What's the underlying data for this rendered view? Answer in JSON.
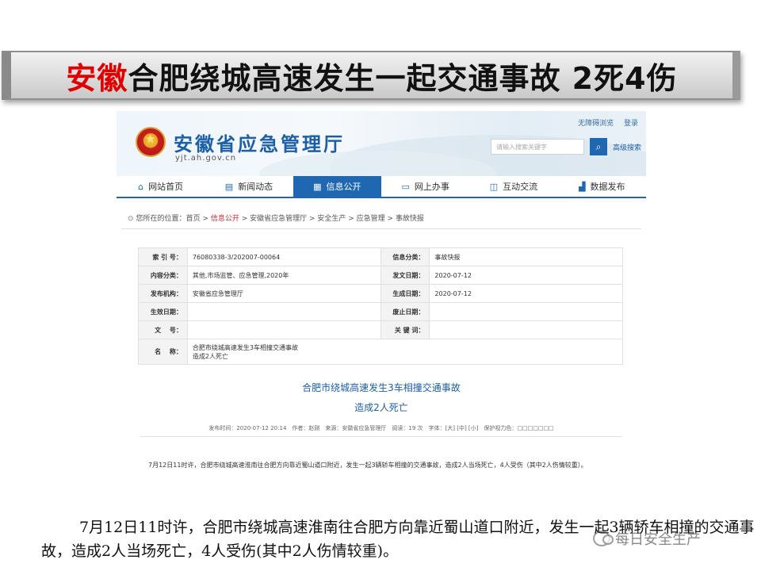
{
  "slide_title": {
    "part_red": "安徽",
    "part_dark": "合肥绕城高速发生一起交通事故 2死4伤"
  },
  "site": {
    "name": "安徽省应急管理厅",
    "domain": "yjt.ah.gov.cn",
    "top_links": [
      "无障碍浏览",
      "登录"
    ],
    "search_placeholder": "请输入搜索关键字",
    "search_icon": "search-icon",
    "advanced_search": "高级搜索",
    "nav": [
      {
        "label": "网站首页",
        "icon": "home-icon"
      },
      {
        "label": "新闻动态",
        "icon": "news-icon"
      },
      {
        "label": "信息公开",
        "icon": "info-icon",
        "active": true
      },
      {
        "label": "网上办事",
        "icon": "monitor-icon"
      },
      {
        "label": "互动交流",
        "icon": "chat-icon"
      },
      {
        "label": "数据发布",
        "icon": "chart-icon"
      }
    ],
    "breadcrumb": {
      "prefix": "您所在的位置：",
      "home": "首页",
      "sep": " > ",
      "current": "信息公开",
      "rest": " > 安徽省应急管理厅 > 安全生产 > 应急管理 > 事故快报"
    },
    "meta": {
      "index_label": "索 引 号：",
      "index_value": "76080338-3/202007-00064",
      "category_label": "信息分类：",
      "category_value": "事故快报",
      "content_label": "内容分类：",
      "content_value": "其他,市场监管、应急管理,2020年",
      "pubdate_label": "发文日期：",
      "pubdate_value": "2020-07-12",
      "org_label": "发布机构：",
      "org_value": "安徽省应急管理厅",
      "gen_label": "生成日期：",
      "gen_value": "2020-07-12",
      "effective_label": "生效日期：",
      "effective_value": "",
      "repeal_label": "废止日期：",
      "repeal_value": "",
      "docno_label": "文　 号：",
      "docno_value": "",
      "keyword_label": "关 键 词：",
      "keyword_value": "",
      "name_label": "名　 称：",
      "name_value_1": "合肥市绕城高速发生3车相撞交通事故",
      "name_value_2": "造成2人死亡"
    },
    "article": {
      "title_1": "合肥市绕城高速发生3车相撞交通事故",
      "title_2": "造成2人死亡",
      "info": "发布时间：2020-07-12 20:14　作者：赵刚　来源：安徽省应急管理厅　阅读：19 次　字体：[大] [中] [小]　保护视力色：□□□□□□□",
      "body": "7月12日11时许，合肥市绕城高速淮南往合肥方向靠近蜀山道口附近，发生一起3辆轿车相撞的交通事故，造成2人当场死亡，4人受伤（其中2人伤情较重）。"
    }
  },
  "caption": "7月12日11时许，合肥市绕城高速淮南往合肥方向靠近蜀山道口附近，发生一起3辆轿车相撞的交通事故，造成2人当场死亡，4人受伤(其中2人伤情较重)。",
  "watermark": {
    "icon": "wechat-icon",
    "text": "每日安全生产"
  },
  "colors": {
    "title_red": "#e00000",
    "site_blue": "#1f67b0",
    "breadcrumb_red": "#c52a2a"
  }
}
